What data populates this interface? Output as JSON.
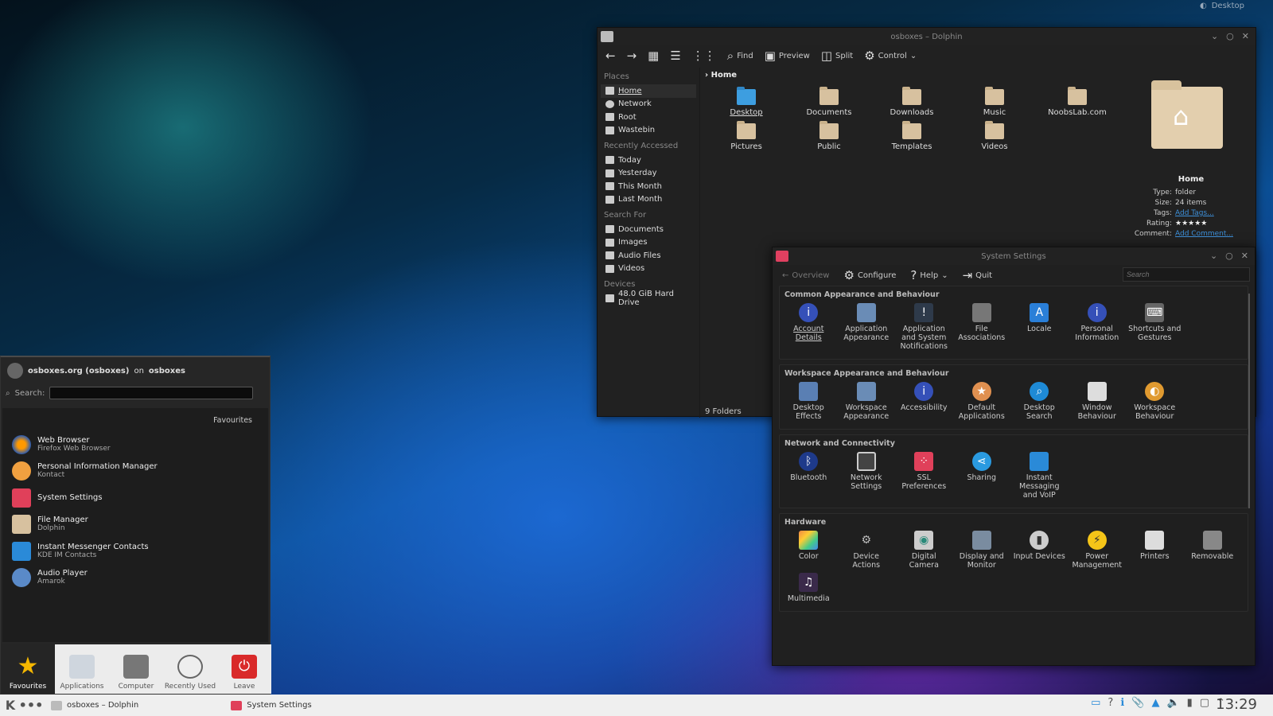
{
  "desktop_label": "Desktop",
  "dolphin": {
    "title": "osboxes – Dolphin",
    "toolbar": {
      "find": "Find",
      "preview": "Preview",
      "split": "Split",
      "control": "Control"
    },
    "places_sections": [
      {
        "header": "Places",
        "items": [
          "Home",
          "Network",
          "Root",
          "Wastebin"
        ]
      },
      {
        "header": "Recently Accessed",
        "items": [
          "Today",
          "Yesterday",
          "This Month",
          "Last Month"
        ]
      },
      {
        "header": "Search For",
        "items": [
          "Documents",
          "Images",
          "Audio Files",
          "Videos"
        ]
      },
      {
        "header": "Devices",
        "items": [
          "48.0 GiB Hard Drive"
        ]
      }
    ],
    "breadcrumb": "Home",
    "folders": [
      "Desktop",
      "Documents",
      "Downloads",
      "Music",
      "NoobsLab.com",
      "Pictures",
      "Public",
      "Templates",
      "Videos"
    ],
    "status": "9 Folders",
    "info": {
      "title": "Home",
      "type_k": "Type:",
      "type_v": "folder",
      "size_k": "Size:",
      "size_v": "24 items",
      "tags_k": "Tags:",
      "tags_v": "Add Tags...",
      "rating_k": "Rating:",
      "rating_v": "★★★★★",
      "comment_k": "Comment:",
      "comment_v": "Add Comment..."
    }
  },
  "settings": {
    "title": "System Settings",
    "toolbar": {
      "overview": "Overview",
      "configure": "Configure",
      "help": "Help",
      "quit": "Quit",
      "search_placeholder": "Search"
    },
    "categories": [
      {
        "header": "Common Appearance and Behaviour",
        "items": [
          "Account Details",
          "Application Appearance",
          "Application and System Notifications",
          "File Associations",
          "Locale",
          "Personal Information",
          "Shortcuts and Gestures"
        ]
      },
      {
        "header": "Workspace Appearance and Behaviour",
        "items": [
          "Desktop Effects",
          "Workspace Appearance",
          "Accessibility",
          "Default Applications",
          "Desktop Search",
          "Window Behaviour",
          "Workspace Behaviour"
        ]
      },
      {
        "header": "Network and Connectivity",
        "items": [
          "Bluetooth",
          "Network Settings",
          "SSL Preferences",
          "Sharing",
          "Instant Messaging and VoIP"
        ]
      },
      {
        "header": "Hardware",
        "items": [
          "Color",
          "Device Actions",
          "Digital Camera",
          "Display and Monitor",
          "Input Devices",
          "Power Management",
          "Printers",
          "Removable",
          "Multimedia"
        ]
      }
    ]
  },
  "kickoff": {
    "user": "osboxes.org (osboxes)",
    "on": "on",
    "host": "osboxes",
    "search_label": "Search:",
    "favourites_header": "Favourites",
    "apps": [
      {
        "name": "Web Browser",
        "desc": "Firefox Web Browser"
      },
      {
        "name": "Personal Information Manager",
        "desc": "Kontact"
      },
      {
        "name": "System Settings",
        "desc": ""
      },
      {
        "name": "File Manager",
        "desc": "Dolphin"
      },
      {
        "name": "Instant Messenger Contacts",
        "desc": "KDE IM Contacts"
      },
      {
        "name": "Audio Player",
        "desc": "Amarok"
      }
    ],
    "tabs": [
      "Favourites",
      "Applications",
      "Computer",
      "Recently Used",
      "Leave"
    ]
  },
  "taskbar": {
    "tasks": [
      "osboxes – Dolphin",
      "System Settings"
    ],
    "clock": "13:29"
  }
}
